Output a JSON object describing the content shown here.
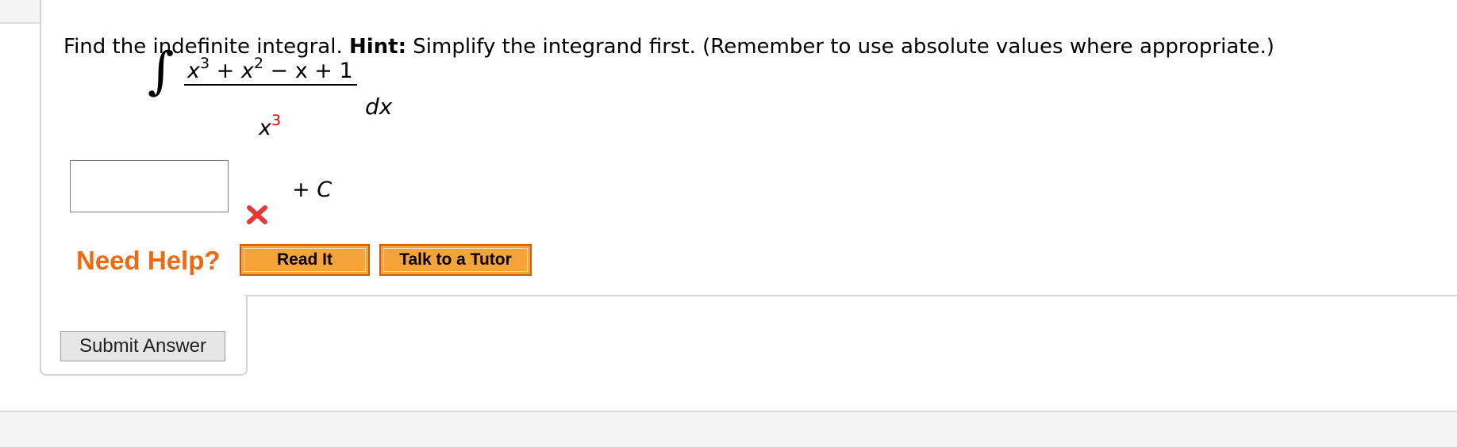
{
  "question": {
    "prefix": "Find the indefinite integral. ",
    "hint_label": "Hint:",
    "suffix": " Simplify the integrand first. (Remember to use absolute values where appropriate.)"
  },
  "integral": {
    "sign": "∫",
    "numerator": {
      "x1": "x",
      "e1": "3",
      "op1": " + ",
      "x2": "x",
      "e2": "2",
      "rest": " − x + 1"
    },
    "denominator": {
      "x": "x",
      "exp": "3"
    },
    "differential": "dx"
  },
  "answer": {
    "value": "",
    "constant": "+ ",
    "constant_var": "C"
  },
  "help": {
    "label": "Need Help?",
    "read_it": "Read It",
    "talk_to_tutor": "Talk to a Tutor"
  },
  "submit": {
    "label": "Submit Answer"
  },
  "colors": {
    "tab_border": "#1f4f86",
    "help_orange": "#ee6a11",
    "incorrect_red": "#e53935",
    "button_orange": "#f6a33a"
  },
  "icons": {
    "incorrect": "x-mark-icon"
  }
}
